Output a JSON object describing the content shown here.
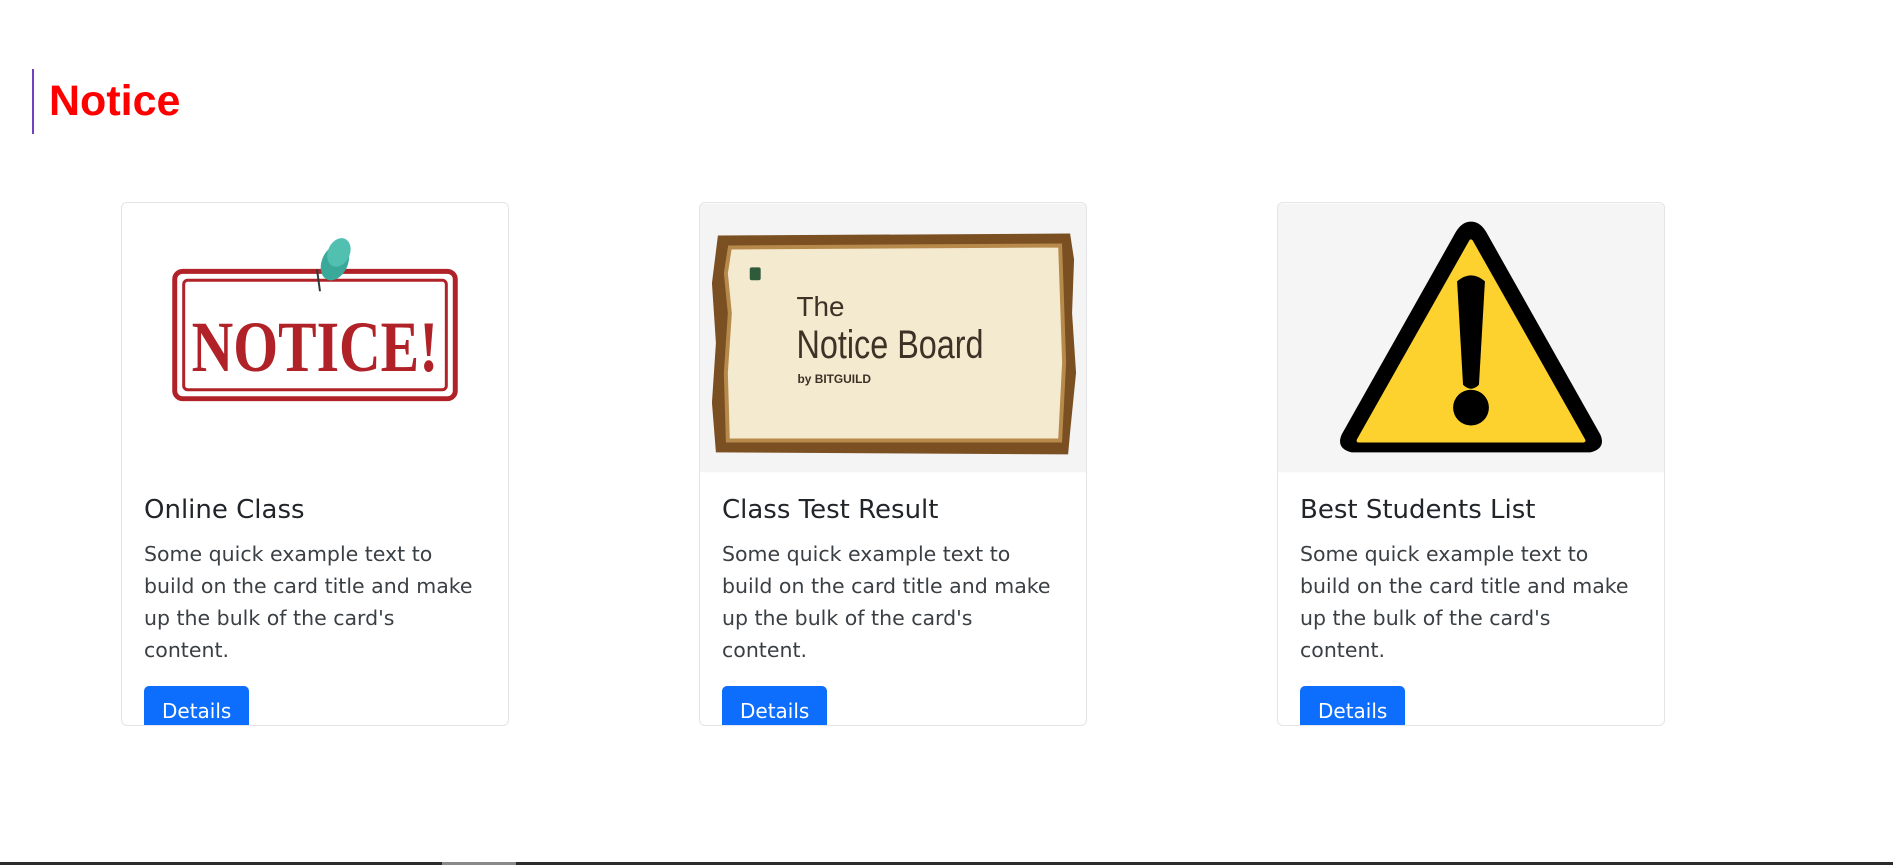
{
  "page": {
    "heading": "Notice",
    "heading_color": "#ff0000",
    "accent_border_color": "#6f42c1"
  },
  "cards": [
    {
      "title": "Online Class",
      "text": "Some quick example text to build on the card title and make up the bulk of the card's content.",
      "button_label": "Details",
      "image": {
        "type": "notice-stamp-icon",
        "lettering": "NOTICE!",
        "colors": {
          "stamp": "#b02228",
          "pin": "#3aa99a"
        }
      }
    },
    {
      "title": "Class Test Result",
      "text": "Some quick example text to build on the card title and make up the bulk of the card's content.",
      "button_label": "Details",
      "image": {
        "type": "parchment-board-icon",
        "lettering": [
          "The",
          "Notice Board",
          "by BITGUILD"
        ],
        "colors": {
          "frame": "#7a4f22",
          "parchment": "#f4ead0"
        }
      }
    },
    {
      "title": "Best Students List",
      "text": "Some quick example text to build on the card title and make up the bulk of the card's content.",
      "button_label": "Details",
      "image": {
        "type": "warning-triangle-icon",
        "colors": {
          "fill": "#fdd22e",
          "stroke": "#000000",
          "background": "#f5f5f5"
        }
      }
    }
  ],
  "theme": {
    "button_color": "#0d6efd",
    "button_text_color": "#ffffff"
  }
}
